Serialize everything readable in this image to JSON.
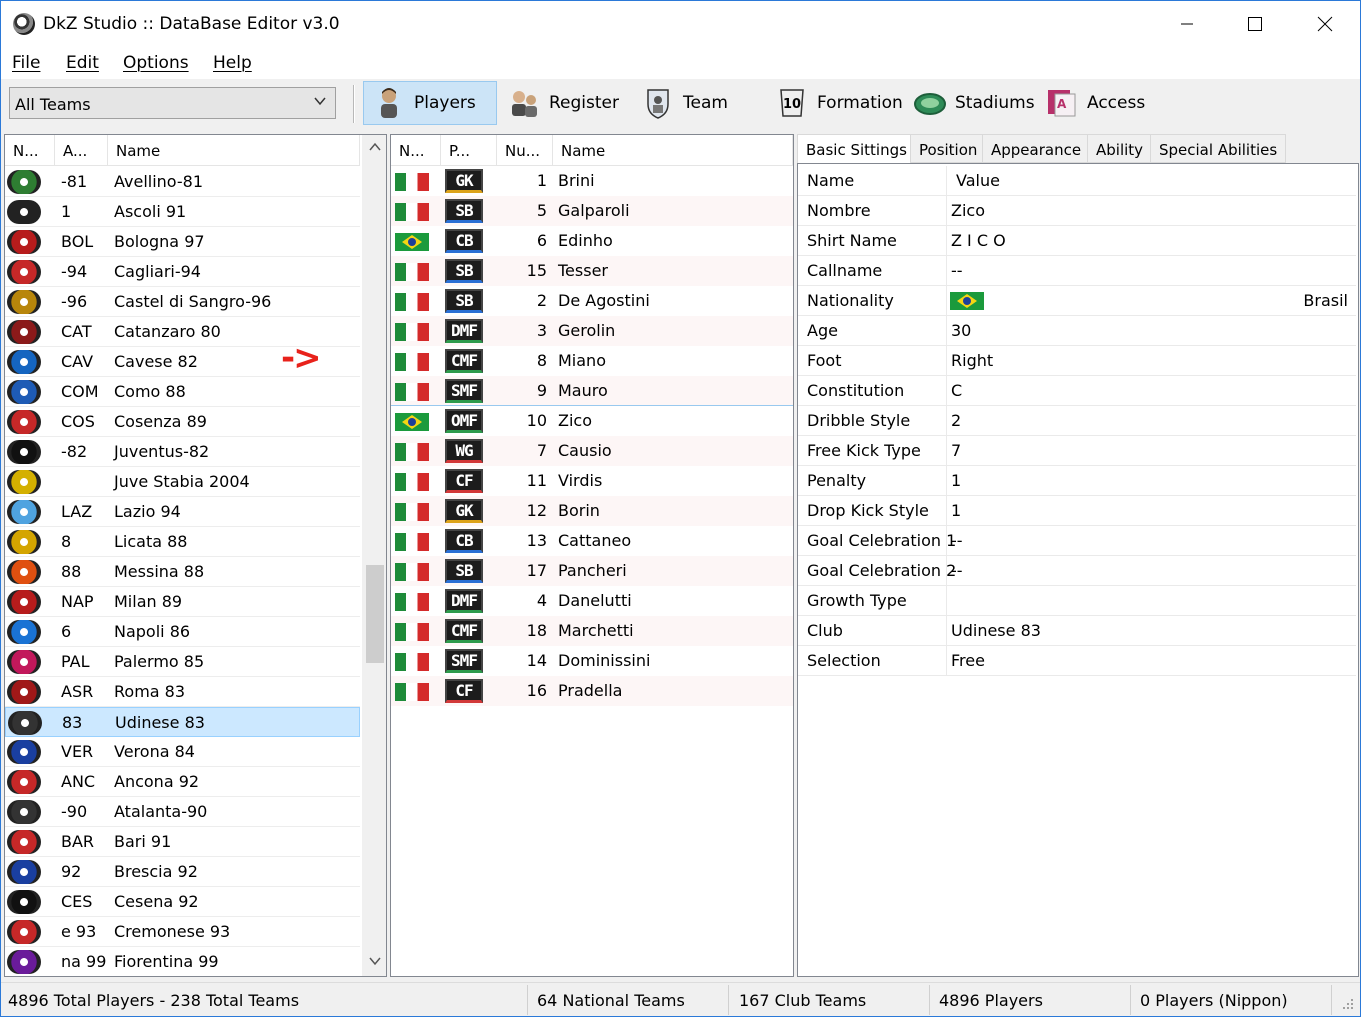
{
  "window": {
    "title": "DkZ Studio :: DataBase Editor v3.0"
  },
  "menu": [
    "File",
    "Edit",
    "Options",
    "Help"
  ],
  "toolbar": {
    "team_filter": "All Teams",
    "buttons": [
      {
        "label": "Players",
        "icon": "player-icon",
        "active": true
      },
      {
        "label": "Register",
        "icon": "register-icon"
      },
      {
        "label": "Team",
        "icon": "team-icon"
      },
      {
        "label": "Formation",
        "icon": "formation-icon"
      },
      {
        "label": "Stadiums",
        "icon": "stadium-icon"
      },
      {
        "label": "Access",
        "icon": "access-icon"
      }
    ]
  },
  "teams": {
    "columns": [
      "N...",
      "A...",
      "Name"
    ],
    "rows": [
      {
        "abbr": "-81",
        "name": "Avellino-81",
        "color": "#2e7d32"
      },
      {
        "abbr": "1",
        "name": "Ascoli 91",
        "color": "#222222"
      },
      {
        "abbr": "BOL",
        "name": "Bologna 97",
        "color": "#b71c1c"
      },
      {
        "abbr": "-94",
        "name": "Cagliari-94",
        "color": "#c62828"
      },
      {
        "abbr": "-96",
        "name": "Castel di Sangro-96",
        "color": "#b8860b"
      },
      {
        "abbr": "CAT",
        "name": "Catanzaro 80",
        "color": "#8b1a1a"
      },
      {
        "abbr": "CAV",
        "name": "Cavese 82",
        "color": "#1565c0"
      },
      {
        "abbr": "COM",
        "name": "Como 88",
        "color": "#1e5bb5"
      },
      {
        "abbr": "COS",
        "name": "Cosenza 89",
        "color": "#c62828"
      },
      {
        "abbr": "-82",
        "name": "Juventus-82",
        "color": "#111111"
      },
      {
        "abbr": "",
        "name": "Juve Stabia 2004",
        "color": "#d4b000"
      },
      {
        "abbr": "LAZ",
        "name": "Lazio 94",
        "color": "#4fa3e0"
      },
      {
        "abbr": "8",
        "name": "Licata 88",
        "color": "#d4a500"
      },
      {
        "abbr": "88",
        "name": "Messina 88",
        "color": "#e05010"
      },
      {
        "abbr": "NAP",
        "name": "Milan 89",
        "color": "#b71c1c"
      },
      {
        "abbr": "6",
        "name": "Napoli 86",
        "color": "#1a73d4"
      },
      {
        "abbr": "PAL",
        "name": "Palermo 85",
        "color": "#c2185b"
      },
      {
        "abbr": "ASR",
        "name": "Roma 83",
        "color": "#a01818"
      },
      {
        "abbr": "83",
        "name": "Udinese 83",
        "color": "#333333",
        "selected": true
      },
      {
        "abbr": "VER",
        "name": "Verona 84",
        "color": "#1a3fa0"
      },
      {
        "abbr": "ANC",
        "name": "Ancona 92",
        "color": "#c62828"
      },
      {
        "abbr": "-90",
        "name": "Atalanta-90",
        "color": "#333333"
      },
      {
        "abbr": "BAR",
        "name": "Bari 91",
        "color": "#c62828"
      },
      {
        "abbr": "92",
        "name": "Brescia 92",
        "color": "#1a3fa0"
      },
      {
        "abbr": "CES",
        "name": "Cesena 92",
        "color": "#111111"
      },
      {
        "abbr": "e 93",
        "name": "Cremonese 93",
        "color": "#c62828"
      },
      {
        "abbr": "na 99",
        "name": "Fiorentina 99",
        "color": "#6a1b9a"
      }
    ]
  },
  "annotation_arrow": "->",
  "players": {
    "columns": [
      "N...",
      "P...",
      "Nu...",
      "Name"
    ],
    "rows": [
      {
        "nat": "it",
        "pos": "GK",
        "num": "1",
        "name": "Brini",
        "group": "gk"
      },
      {
        "nat": "it",
        "pos": "SB",
        "num": "5",
        "name": "Galparoli",
        "group": "def"
      },
      {
        "nat": "br",
        "pos": "CB",
        "num": "6",
        "name": "Edinho",
        "group": "def"
      },
      {
        "nat": "it",
        "pos": "SB",
        "num": "15",
        "name": "Tesser",
        "group": "def"
      },
      {
        "nat": "it",
        "pos": "SB",
        "num": "2",
        "name": "De Agostini",
        "group": "def"
      },
      {
        "nat": "it",
        "pos": "DMF",
        "num": "3",
        "name": "Gerolin",
        "group": "mid"
      },
      {
        "nat": "it",
        "pos": "CMF",
        "num": "8",
        "name": "Miano",
        "group": "mid"
      },
      {
        "nat": "it",
        "pos": "SMF",
        "num": "9",
        "name": "Mauro",
        "group": "mid"
      },
      {
        "nat": "br",
        "pos": "OMF",
        "num": "10",
        "name": "Zico",
        "group": "mid",
        "selected": true
      },
      {
        "nat": "it",
        "pos": "WG",
        "num": "7",
        "name": "Causio",
        "group": "fwd"
      },
      {
        "nat": "it",
        "pos": "CF",
        "num": "11",
        "name": "Virdis",
        "group": "fwd"
      },
      {
        "nat": "it",
        "pos": "GK",
        "num": "12",
        "name": "Borin",
        "group": "gk"
      },
      {
        "nat": "it",
        "pos": "CB",
        "num": "13",
        "name": "Cattaneo",
        "group": "def"
      },
      {
        "nat": "it",
        "pos": "SB",
        "num": "17",
        "name": "Pancheri",
        "group": "def"
      },
      {
        "nat": "it",
        "pos": "DMF",
        "num": "4",
        "name": "Danelutti",
        "group": "mid"
      },
      {
        "nat": "it",
        "pos": "CMF",
        "num": "18",
        "name": "Marchetti",
        "group": "mid"
      },
      {
        "nat": "it",
        "pos": "SMF",
        "num": "14",
        "name": "Dominissini",
        "group": "mid"
      },
      {
        "nat": "it",
        "pos": "CF",
        "num": "16",
        "name": "Pradella",
        "group": "fwd"
      }
    ]
  },
  "props": {
    "tabs": [
      "Basic Sittings",
      "Position",
      "Appearance",
      "Ability",
      "Special Abilities"
    ],
    "active_tab": "Basic Sittings",
    "header": {
      "key": "Name",
      "value": "Value"
    },
    "rows": [
      {
        "key": "Nombre",
        "value": "Zico"
      },
      {
        "key": "Shirt Name",
        "value": "Z I C O"
      },
      {
        "key": "Callname",
        "value": "--"
      },
      {
        "key": "Nationality",
        "value": "Brasil",
        "flag": "br"
      },
      {
        "key": "Age",
        "value": "30"
      },
      {
        "key": "Foot",
        "value": "Right"
      },
      {
        "key": "Constitution",
        "value": "C"
      },
      {
        "key": "Dribble Style",
        "value": "2"
      },
      {
        "key": "Free Kick Type",
        "value": "7"
      },
      {
        "key": "Penalty",
        "value": "1"
      },
      {
        "key": "Drop Kick Style",
        "value": "1"
      },
      {
        "key": "Goal Celebration 1",
        "value": "--"
      },
      {
        "key": "Goal Celebration 2",
        "value": "--"
      },
      {
        "key": "Growth Type",
        "value": ""
      },
      {
        "key": "Club",
        "value": "Udinese 83"
      },
      {
        "key": "Selection",
        "value": "Free"
      }
    ]
  },
  "status": {
    "totals": "4896 Total Players  -  238 Total Teams",
    "national": "64 National Teams",
    "club": "167 Club Teams",
    "players": "4896 Players",
    "nippon": "0 Players (Nippon)"
  }
}
